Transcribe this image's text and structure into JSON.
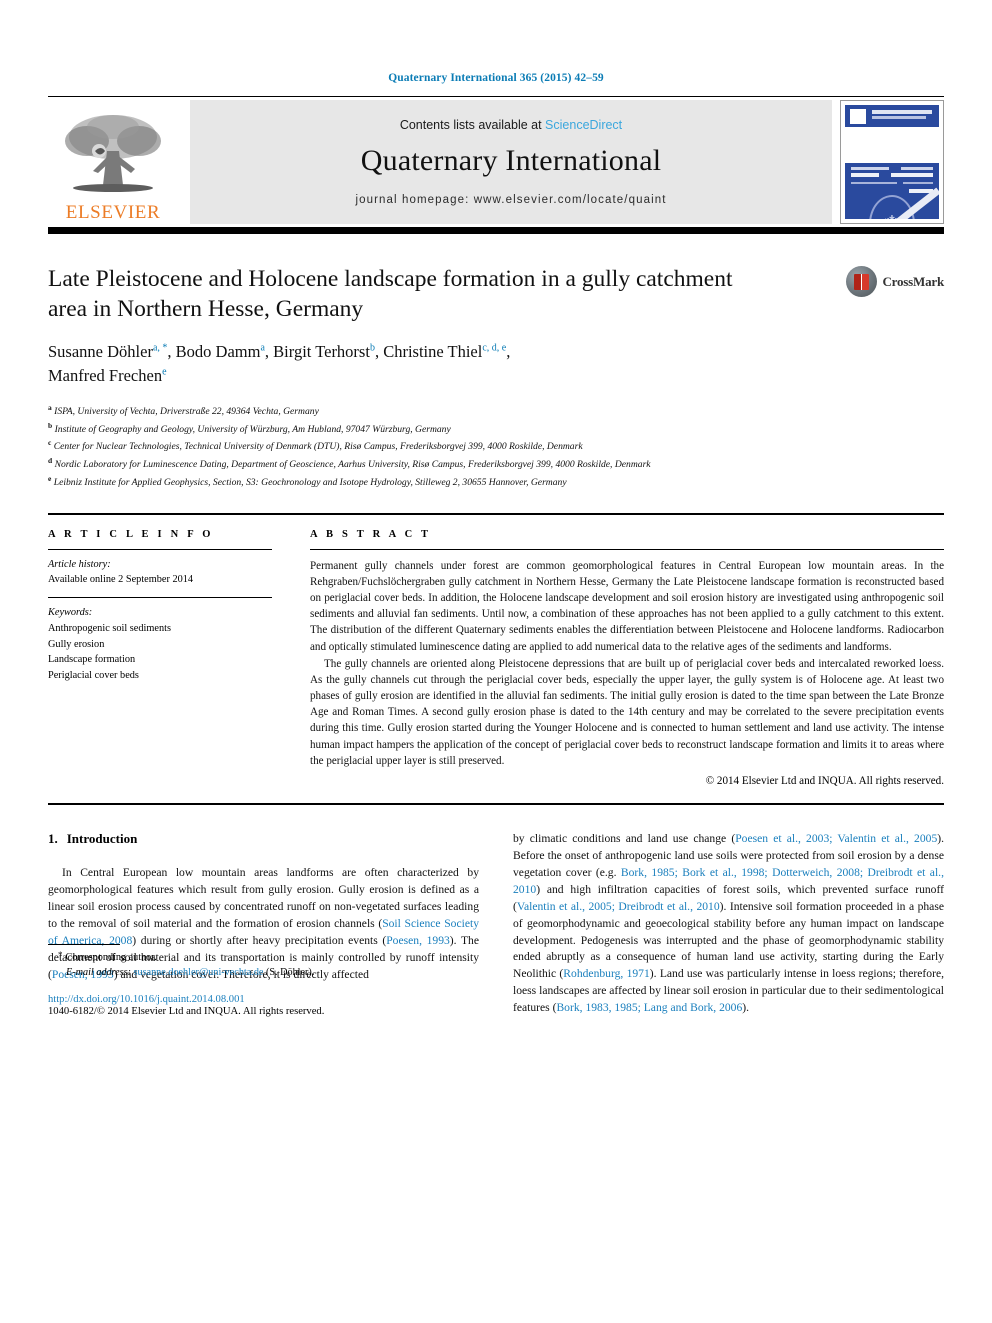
{
  "journal_ref": "Quaternary International 365 (2015) 42–59",
  "masthead": {
    "contents_prefix": "Contents lists available at ",
    "sciencedirect": "ScienceDirect",
    "journal_title": "Quaternary International",
    "homepage": "journal homepage: www.elsevier.com/locate/quaint",
    "publisher_logo_text": "ELSEVIER",
    "cover_alt": "journal-cover-thumbnail"
  },
  "article": {
    "title": "Late Pleistocene and Holocene landscape formation in a gully catchment area in Northern Hesse, Germany",
    "crossmark_label": "CrossMark",
    "authors_line1": "Susanne Döhler a, *, Bodo Damm a, Birgit Terhorst b, Christine Thiel c, d, e,",
    "authors_line2": "Manfred Frechen e",
    "authors": [
      {
        "name": "Susanne Döhler",
        "sup": "a, *"
      },
      {
        "name": "Bodo Damm",
        "sup": "a"
      },
      {
        "name": "Birgit Terhorst",
        "sup": "b"
      },
      {
        "name": "Christine Thiel",
        "sup": "c, d, e"
      },
      {
        "name": "Manfred Frechen",
        "sup": "e"
      }
    ],
    "affiliations": [
      {
        "mark": "a",
        "text": "ISPA, University of Vechta, Driverstraße 22, 49364 Vechta, Germany"
      },
      {
        "mark": "b",
        "text": "Institute of Geography and Geology, University of Würzburg, Am Hubland, 97047 Würzburg, Germany"
      },
      {
        "mark": "c",
        "text": "Center for Nuclear Technologies, Technical University of Denmark (DTU), Risø Campus, Frederiksborgvej 399, 4000 Roskilde, Denmark"
      },
      {
        "mark": "d",
        "text": "Nordic Laboratory for Luminescence Dating, Department of Geoscience, Aarhus University, Risø Campus, Frederiksborgvej 399, 4000 Roskilde, Denmark"
      },
      {
        "mark": "e",
        "text": "Leibniz Institute for Applied Geophysics, Section, S3: Geochronology and Isotope Hydrology, Stilleweg 2, 30655 Hannover, Germany"
      }
    ]
  },
  "article_info": {
    "heading": "A R T I C L E  I N F O",
    "history_label": "Article history:",
    "history_value": "Available online 2 September 2014",
    "keywords_label": "Keywords:",
    "keywords": [
      "Anthropogenic soil sediments",
      "Gully erosion",
      "Landscape formation",
      "Periglacial cover beds"
    ]
  },
  "abstract": {
    "heading": "A B S T R A C T",
    "paragraph1": "Permanent gully channels under forest are common geomorphological features in Central European low mountain areas. In the Rehgraben/Fuchslöchergraben gully catchment in Northern Hesse, Germany the Late Pleistocene landscape formation is reconstructed based on periglacial cover beds. In addition, the Holocene landscape development and soil erosion history are investigated using anthropogenic soil sediments and alluvial fan sediments. Until now, a combination of these approaches has not been applied to a gully catchment to this extent. The distribution of the different Quaternary sediments enables the differentiation between Pleistocene and Holocene landforms. Radiocarbon and optically stimulated luminescence dating are applied to add numerical data to the relative ages of the sediments and landforms.",
    "paragraph2": "The gully channels are oriented along Pleistocene depressions that are built up of periglacial cover beds and intercalated reworked loess. As the gully channels cut through the periglacial cover beds, especially the upper layer, the gully system is of Holocene age. At least two phases of gully erosion are identified in the alluvial fan sediments. The initial gully erosion is dated to the time span between the Late Bronze Age and Roman Times. A second gully erosion phase is dated to the 14th century and may be correlated to the severe precipitation events during this time. Gully erosion started during the Younger Holocene and is connected to human settlement and land use activity. The intense human impact hampers the application of the concept of periglacial cover beds to reconstruct landscape formation and limits it to areas where the periglacial upper layer is still preserved.",
    "copyright": "© 2014 Elsevier Ltd and INQUA. All rights reserved."
  },
  "introduction": {
    "number": "1.",
    "heading": "Introduction",
    "left_p1_a": "In Central European low mountain areas landforms are often characterized by geomorphological features which result from gully erosion. Gully erosion is defined as a linear soil erosion process caused by concentrated runoff on non-vegetated surfaces leading to the removal of soil material and the formation of erosion channels (",
    "left_cite1": "Soil Science Society of America, 2008",
    "left_p1_b": ") during or shortly after heavy precipitation events (",
    "left_cite2": "Poesen, 1993",
    "left_p1_c": "). The detachment of soil material and its transportation is mainly controlled by runoff intensity (",
    "left_cite3": "Poesen, 1993",
    "left_p1_d": ") and vegetation cover. Therefore, it is directly affected",
    "right_p1_a": "by climatic conditions and land use change (",
    "right_cite1": "Poesen et al., 2003; Valentin et al., 2005",
    "right_p1_b": "). Before the onset of anthropogenic land use soils were protected from soil erosion by a dense vegetation cover (e.g. ",
    "right_cite2": "Bork, 1985; Bork et al., 1998; Dotterweich, 2008; Dreibrodt et al., 2010",
    "right_p1_c": ") and high infiltration capacities of forest soils, which prevented surface runoff (",
    "right_cite3": "Valentin et al., 2005; Dreibrodt et al., 2010",
    "right_p1_d": "). Intensive soil formation proceeded in a phase of geomorphodynamic and geoecological stability before any human impact on landscape development. Pedogenesis was interrupted and the phase of geomorphodynamic stability ended abruptly as a consequence of human land use activity, starting during the Early Neolithic (",
    "right_cite4": "Rohdenburg, 1971",
    "right_p1_e": "). Land use was particularly intense in loess regions; therefore, loess landscapes are affected by linear soil erosion in particular due to their sedimentological features (",
    "right_cite5": "Bork, 1983, 1985; Lang and Bork, 2006",
    "right_p1_f": ")."
  },
  "footer": {
    "corresponding_label": "Corresponding author.",
    "email_label": "E-mail address:",
    "email": "susanne.doehler@uni-vechta.de",
    "email_suffix": "(S. Döhler).",
    "doi": "http://dx.doi.org/10.1016/j.quaint.2014.08.001",
    "issn_line": "1040-6182/© 2014 Elsevier Ltd and INQUA. All rights reserved."
  },
  "colors": {
    "link": "#1a7fbd",
    "journal_ref": "#0b7cb5",
    "elsevier_orange": "#ec7c26",
    "band_gray": "#e7e7e7"
  }
}
